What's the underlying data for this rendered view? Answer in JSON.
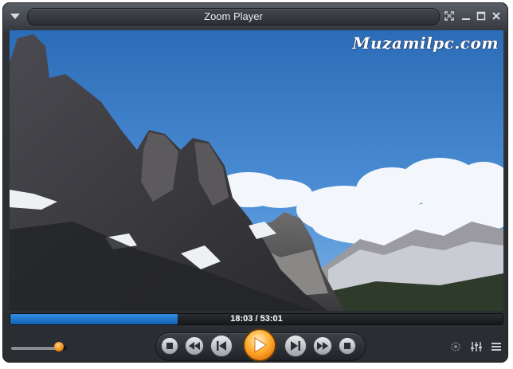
{
  "window": {
    "title": "Zoom Player"
  },
  "video": {
    "watermark": "Muzamilpc.com"
  },
  "seek": {
    "time_text": "18:03 / 53:01",
    "progress_fraction": 0.34
  },
  "volume": {
    "level_fraction": 0.85
  },
  "icons": {
    "menu": "triangle-down-icon",
    "fullscreen": "fullscreen-icon",
    "minimize": "minimize-icon",
    "maximize": "maximize-icon",
    "close": "close-icon",
    "stop": "stop-icon",
    "rewind": "rewind-icon",
    "prev": "skip-previous-icon",
    "play": "play-icon",
    "next": "skip-next-icon",
    "forward": "fast-forward-icon",
    "eject": "eject-icon",
    "settings": "settings-icon",
    "equalizer": "equalizer-icon",
    "playlist": "playlist-icon"
  },
  "colors": {
    "accent": "#2f8ee3",
    "play": "#ffad2e",
    "chrome": "#2a2d31"
  }
}
